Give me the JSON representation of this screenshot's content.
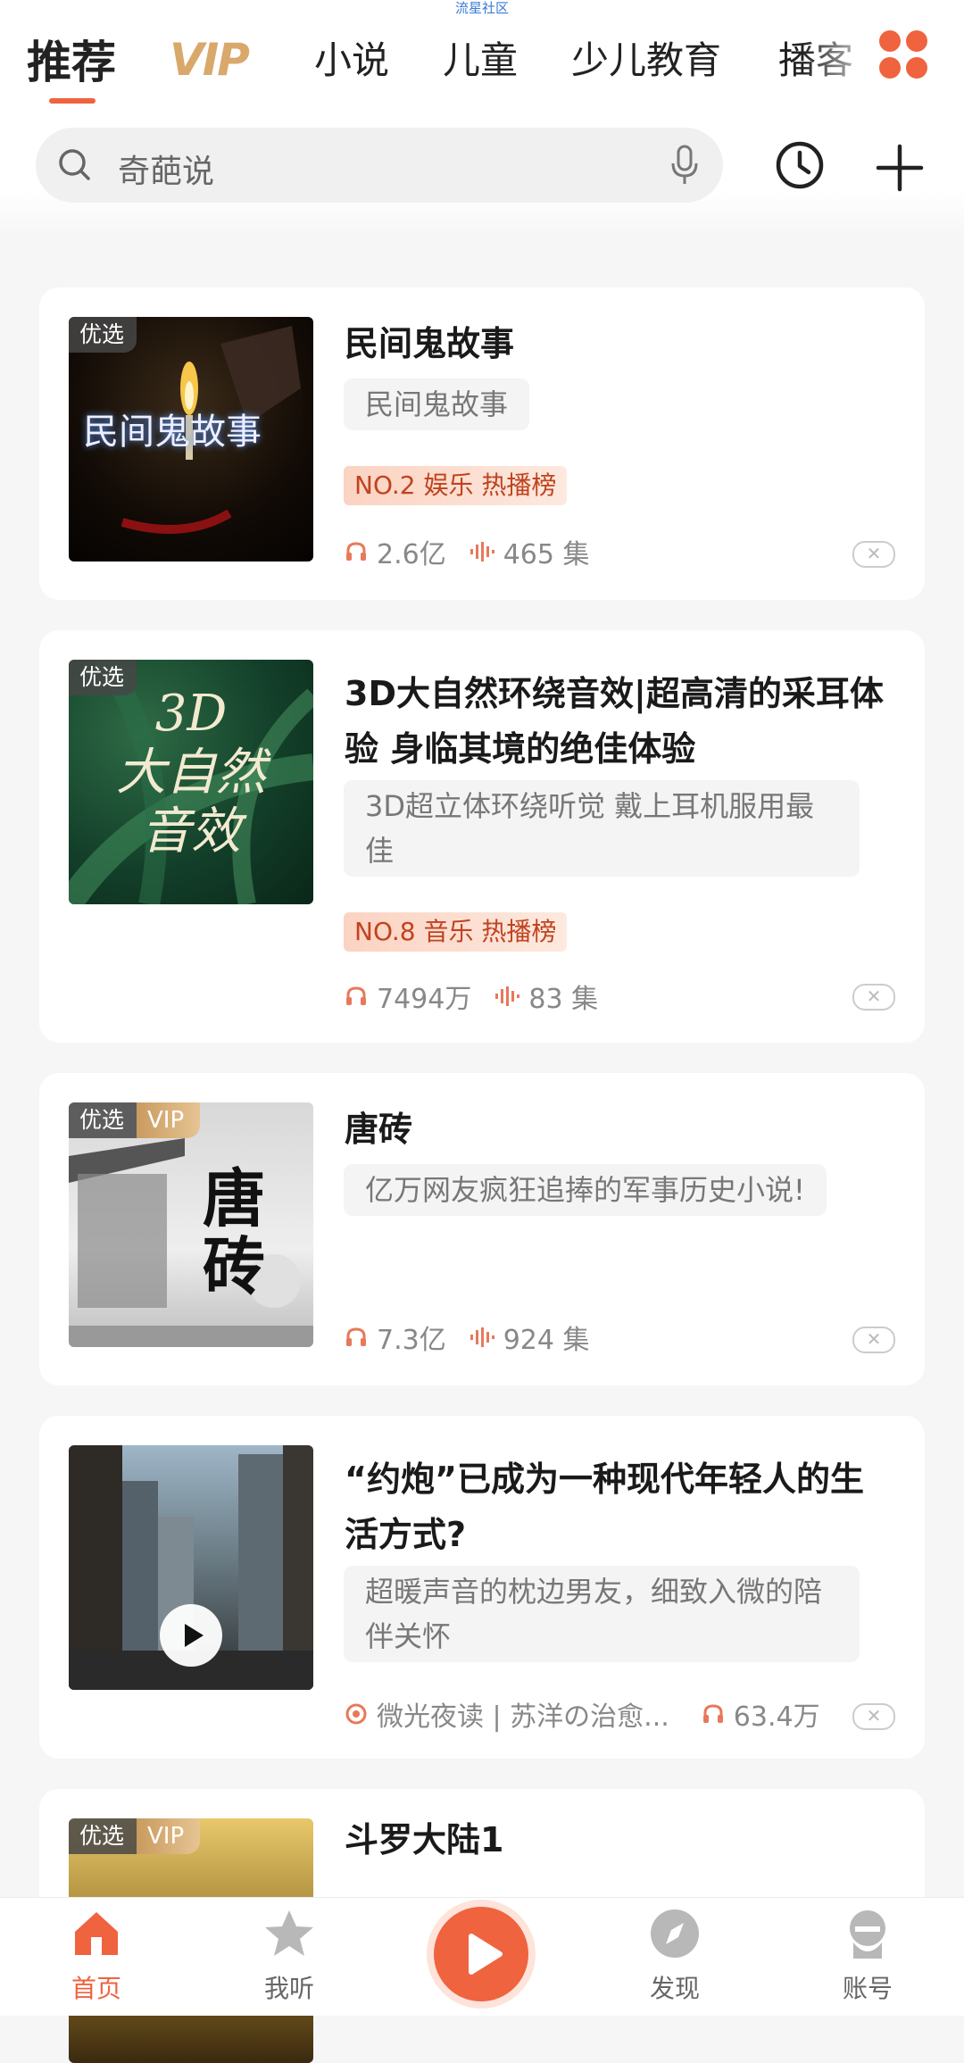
{
  "status": {
    "text": "流星社区"
  },
  "tabs": [
    {
      "label": "推荐",
      "active": true
    },
    {
      "label": "VIP"
    },
    {
      "label": "小说"
    },
    {
      "label": "儿童"
    },
    {
      "label": "少儿教育"
    },
    {
      "label": "播客"
    }
  ],
  "search": {
    "placeholder": "奇葩说"
  },
  "colors": {
    "accent": "#f0633f",
    "vip_gold": "#d9a86b",
    "rank_text": "#c0431f"
  },
  "cards": [
    {
      "badge": "优选",
      "title": "民间鬼故事",
      "cover_text": "民间鬼故事",
      "desc": "民间鬼故事",
      "rank": "NO.2 娱乐 热播榜",
      "plays": "2.6亿",
      "episodes": "465 集"
    },
    {
      "badge": "优选",
      "title": "3D大自然环绕音效|超高清的采耳体验 身临其境的绝佳体验",
      "cover_text_1": "3D",
      "cover_text_2": "大自然",
      "cover_text_3": "音效",
      "desc": "3D超立体环绕听觉 戴上耳机服用最佳",
      "rank": "NO.8 音乐 热播榜",
      "plays": "7494万",
      "episodes": "83 集"
    },
    {
      "badge": "优选",
      "vip": "VIP",
      "title": "唐砖",
      "cover_text": "唐砖",
      "desc": "亿万网友疯狂追捧的军事历史小说!",
      "plays": "7.3亿",
      "episodes": "924 集"
    },
    {
      "title": "“约炮”已成为一种现代年轻人的生活方式?",
      "desc": "超暖声音的枕边男友，细致入微的陪伴关怀",
      "author": "微光夜读 | 苏洋の治愈...",
      "plays": "63.4万"
    },
    {
      "badge": "优选",
      "vip": "VIP",
      "title": "斗罗大陆1"
    }
  ],
  "bottom_nav": [
    {
      "label": "首页",
      "icon": "home-icon",
      "active": true
    },
    {
      "label": "我听",
      "icon": "star-icon"
    },
    {
      "label": "",
      "icon": "play-icon"
    },
    {
      "label": "发现",
      "icon": "compass-icon"
    },
    {
      "label": "账号",
      "icon": "account-icon"
    }
  ]
}
